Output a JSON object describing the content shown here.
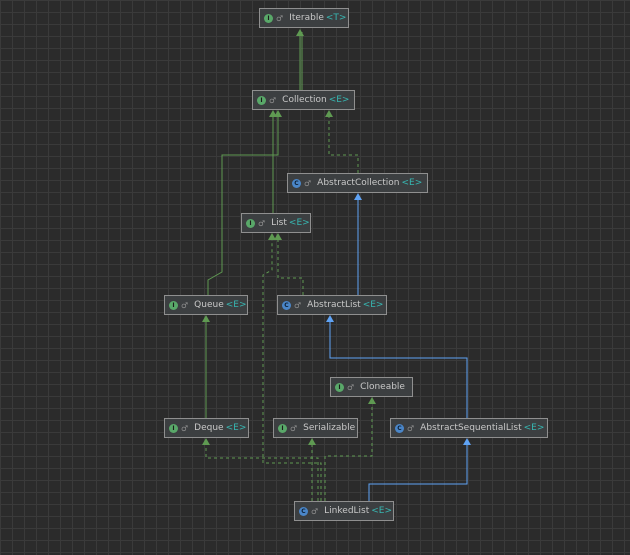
{
  "colors": {
    "extends_interface": "#5f9a52",
    "implements": "#5f9a52",
    "extends_class": "#5fa3f5",
    "interface_icon": "#59a869",
    "class_icon": "#4a86c8",
    "type_param": "#37b7b2"
  },
  "nodes": {
    "iterable": {
      "kind": "interface",
      "icon_letter": "I",
      "visibility_icon": "unlocked-icon",
      "name": "Iterable",
      "type_param": "<T>"
    },
    "collection": {
      "kind": "interface",
      "icon_letter": "I",
      "visibility_icon": "unlocked-icon",
      "name": "Collection",
      "type_param": "<E>"
    },
    "abstract_collection": {
      "kind": "class",
      "icon_letter": "C",
      "visibility_icon": "unlocked-icon",
      "name": "AbstractCollection",
      "type_param": "<E>"
    },
    "list": {
      "kind": "interface",
      "icon_letter": "I",
      "visibility_icon": "unlocked-icon",
      "name": "List",
      "type_param": "<E>"
    },
    "queue": {
      "kind": "interface",
      "icon_letter": "I",
      "visibility_icon": "unlocked-icon",
      "name": "Queue",
      "type_param": "<E>"
    },
    "abstract_list": {
      "kind": "class",
      "icon_letter": "C",
      "visibility_icon": "unlocked-icon",
      "name": "AbstractList",
      "type_param": "<E>"
    },
    "cloneable": {
      "kind": "interface",
      "icon_letter": "I",
      "visibility_icon": "unlocked-icon",
      "name": "Cloneable",
      "type_param": ""
    },
    "deque": {
      "kind": "interface",
      "icon_letter": "I",
      "visibility_icon": "unlocked-icon",
      "name": "Deque",
      "type_param": "<E>"
    },
    "serializable": {
      "kind": "interface",
      "icon_letter": "I",
      "visibility_icon": "unlocked-icon",
      "name": "Serializable",
      "type_param": ""
    },
    "abstract_sequential_list": {
      "kind": "class",
      "icon_letter": "C",
      "visibility_icon": "unlocked-icon",
      "name": "AbstractSequentialList",
      "type_param": "<E>"
    },
    "linked_list": {
      "kind": "class",
      "icon_letter": "C",
      "visibility_icon": "unlocked-icon",
      "name": "LinkedList",
      "type_param": "<E>"
    }
  },
  "edges": [
    {
      "from": "collection",
      "to": "iterable",
      "type": "extends"
    },
    {
      "from": "abstract_collection",
      "to": "collection",
      "type": "implements"
    },
    {
      "from": "list",
      "to": "collection",
      "type": "extends"
    },
    {
      "from": "queue",
      "to": "collection",
      "type": "extends"
    },
    {
      "from": "abstract_list",
      "to": "abstract_collection",
      "type": "extends"
    },
    {
      "from": "abstract_list",
      "to": "list",
      "type": "implements"
    },
    {
      "from": "deque",
      "to": "queue",
      "type": "extends"
    },
    {
      "from": "abstract_sequential_list",
      "to": "abstract_list",
      "type": "extends"
    },
    {
      "from": "linked_list",
      "to": "abstract_sequential_list",
      "type": "extends"
    },
    {
      "from": "linked_list",
      "to": "list",
      "type": "implements"
    },
    {
      "from": "linked_list",
      "to": "deque",
      "type": "implements"
    },
    {
      "from": "linked_list",
      "to": "cloneable",
      "type": "implements"
    },
    {
      "from": "linked_list",
      "to": "serializable",
      "type": "implements"
    }
  ]
}
